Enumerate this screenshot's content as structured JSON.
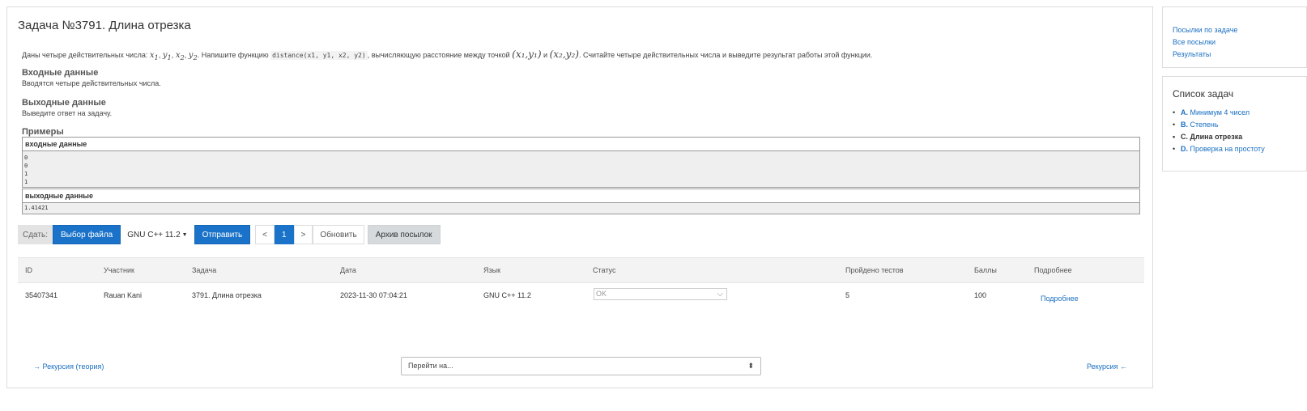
{
  "problem": {
    "title": "Задача №3791. Длина отрезка",
    "statement": {
      "intro": "Даны четыре действительных числа:",
      "vars": [
        "x",
        "y",
        "x",
        "y"
      ],
      "subs": [
        "1",
        "1",
        "2",
        "2"
      ],
      "mid1": ". Напишите функцию",
      "code": "distance(x1, y1, x2, y2)",
      "mid2": ", вычисляющую расстояние между точкой",
      "p1": "(x₁,y₁)",
      "and": "и",
      "p2": "(x₂,y₂)",
      "outro": ". Считайте четыре действительных числа и выведите результат работы этой функции."
    },
    "input_heading": "Входные данные",
    "input_text": "Вводятся четыре действительных числа.",
    "output_heading": "Выходные данные",
    "output_text": "Выведите ответ на задачу.",
    "examples_heading": "Примеры",
    "example": {
      "input_label": "входные данные",
      "input_value": "0\n0\n1\n1",
      "output_label": "выходные данные",
      "output_value": "1.41421"
    }
  },
  "submit_bar": {
    "label": "Сдать:",
    "choose_file": "Выбор файла",
    "compiler": "GNU C++ 11.2",
    "send": "Отправить",
    "prev": "<",
    "page": "1",
    "next": ">",
    "refresh": "Обновить",
    "archive": "Архив посылок"
  },
  "table": {
    "headers": [
      "ID",
      "Участник",
      "Задача",
      "Дата",
      "Язык",
      "Статус",
      "Пройдено тестов",
      "Баллы",
      "Подробнее"
    ],
    "rows": [
      {
        "id": "35407341",
        "participant": "Rauan Kani",
        "task": "3791. Длина отрезка",
        "date": "2023-11-30 07:04:21",
        "lang": "GNU C++ 11.2",
        "status": "OK",
        "tests": "5",
        "score": "100",
        "details": "Подробнее"
      }
    ]
  },
  "footer": {
    "prev_link": "→ Рекурсия (теория)",
    "goto_placeholder": "Перейти на...",
    "next_link": "Рекурсия ←"
  },
  "sidebar": {
    "links": [
      "Посылки по задаче",
      "Все посылки",
      "Результаты"
    ],
    "task_list_title": "Список задач",
    "tasks": [
      {
        "letter": "A.",
        "name": "Минимум 4 чисел"
      },
      {
        "letter": "B.",
        "name": "Степень"
      },
      {
        "letter": "C.",
        "name": "Длина отрезка"
      },
      {
        "letter": "D.",
        "name": "Проверка на простоту"
      }
    ]
  },
  "colors": {
    "accent": "#1a73c9",
    "link": "#1a6fc2"
  }
}
